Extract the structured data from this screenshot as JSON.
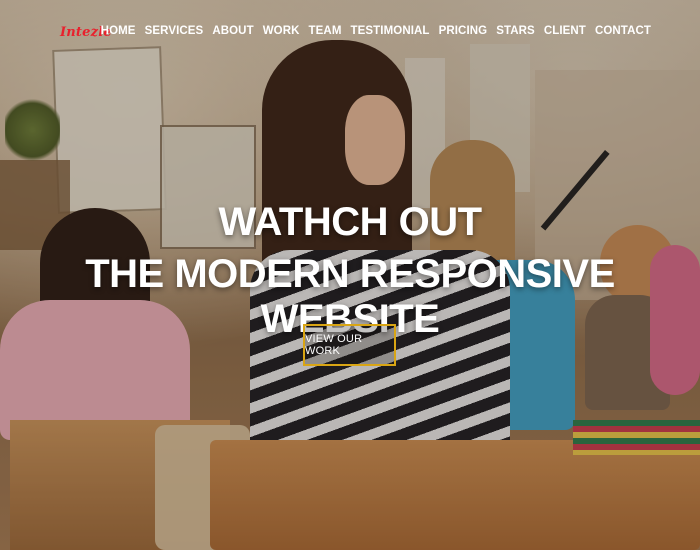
{
  "brand": {
    "logo_text": "Intezle",
    "logo_color": "#e8212d"
  },
  "nav": {
    "items": [
      {
        "label": "HOME"
      },
      {
        "label": "SERVICES"
      },
      {
        "label": "ABOUT"
      },
      {
        "label": "WORK"
      },
      {
        "label": "TEAM"
      },
      {
        "label": "TESTIMONIAL"
      },
      {
        "label": "PRICING"
      },
      {
        "label": "STARS"
      },
      {
        "label": "CLIENT"
      },
      {
        "label": "CONTACT"
      }
    ]
  },
  "hero": {
    "headline_line1": "WATHCH OUT",
    "headline_line2": "THE MODERN RESPONSIVE WEBSITE",
    "cta_label": "VIEW OUR WORK",
    "cta_border_color": "#d9a514"
  }
}
